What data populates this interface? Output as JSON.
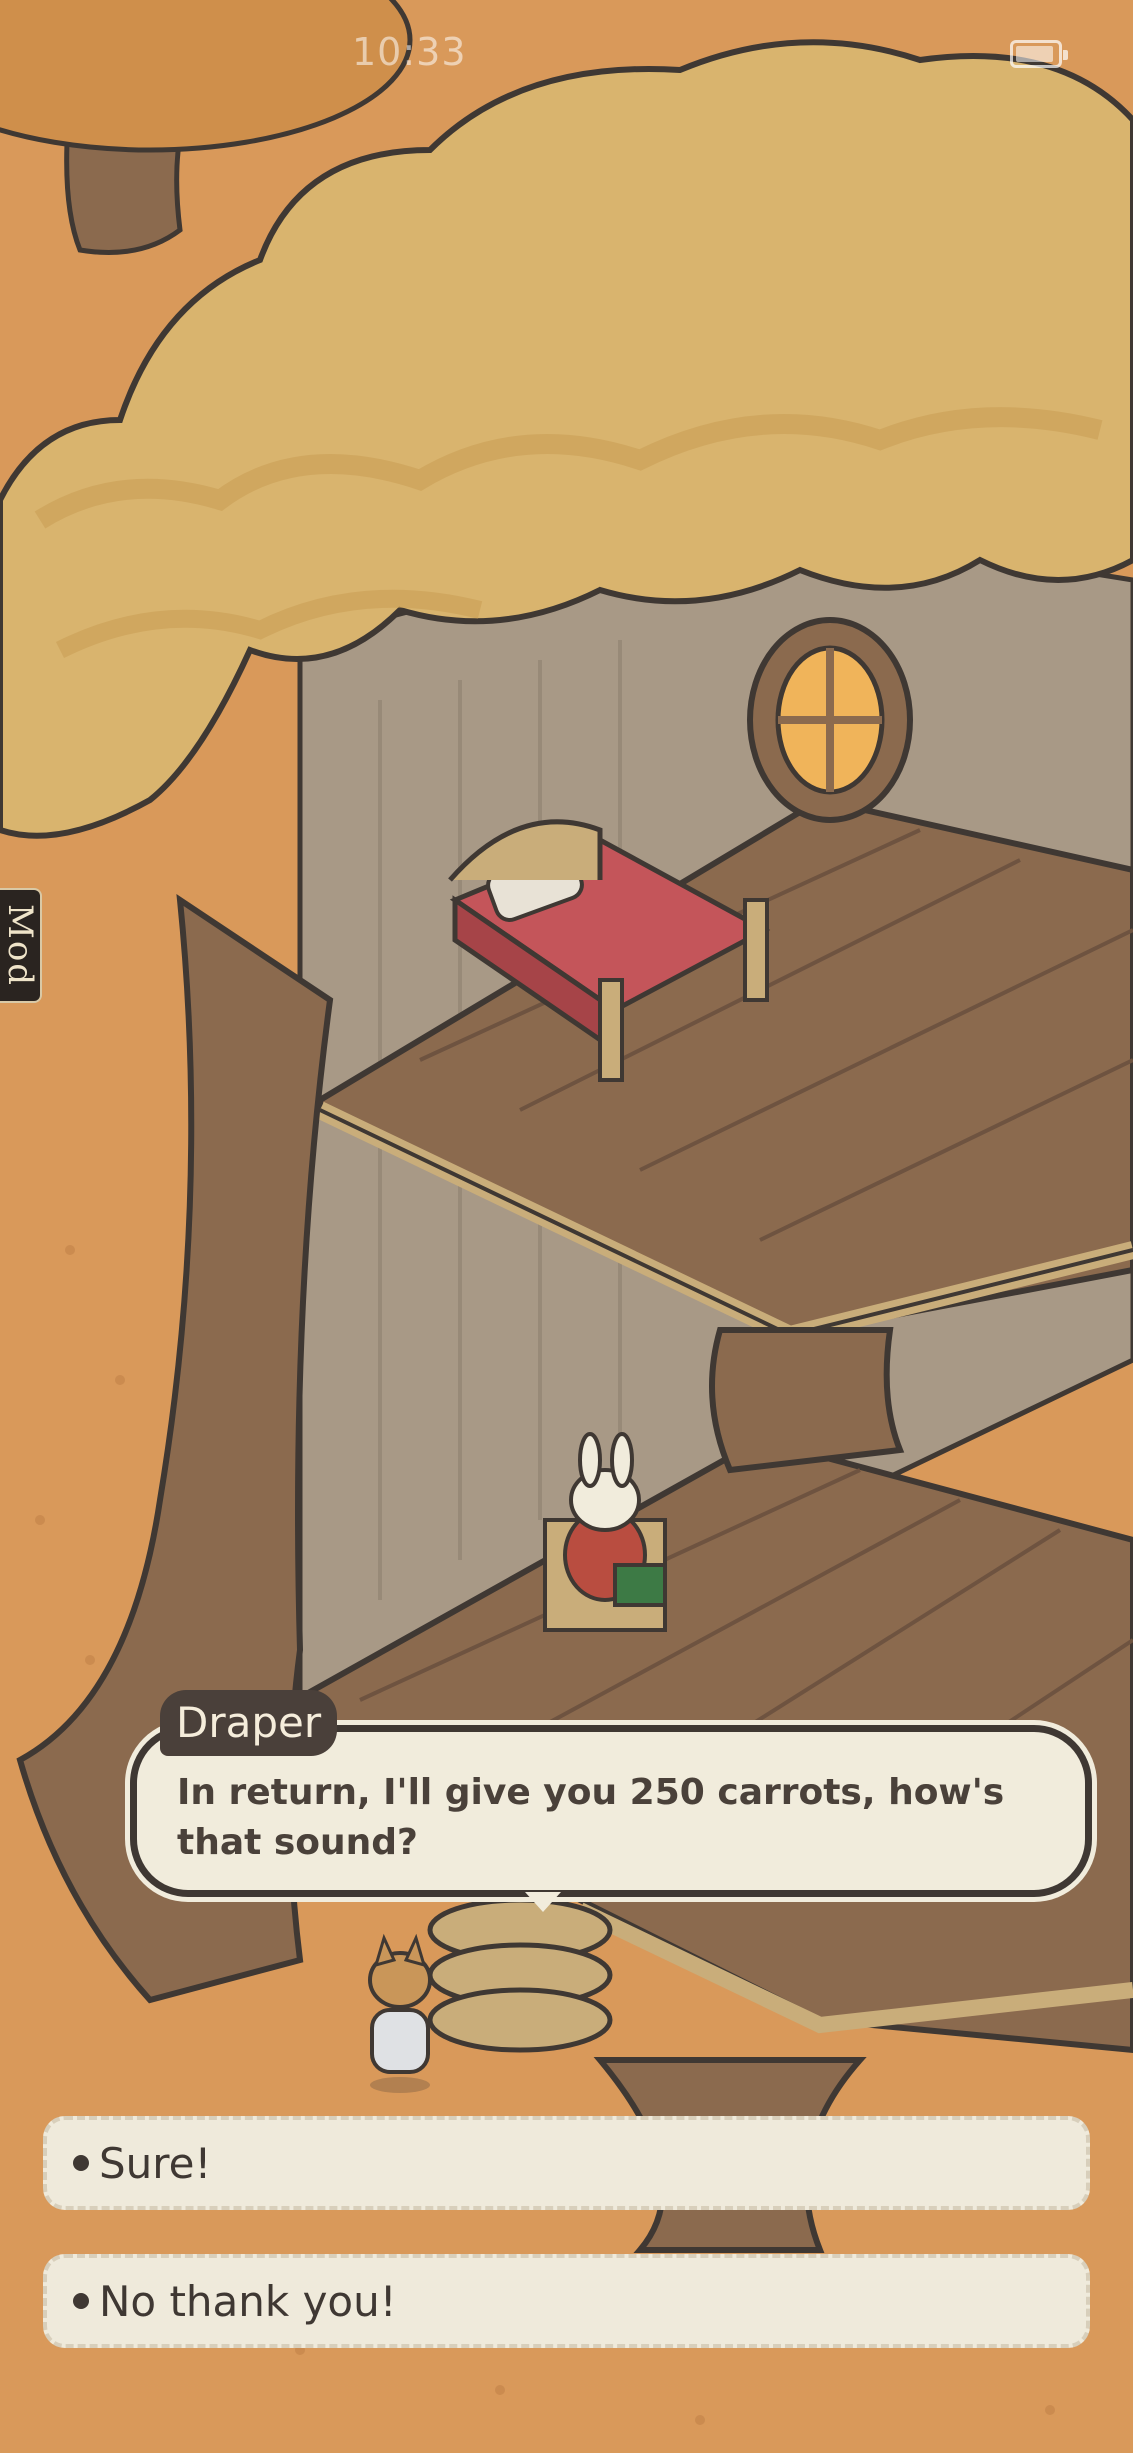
{
  "status_bar": {
    "time": "10:33",
    "battery_icon": "battery-charging-icon"
  },
  "mod_tab": {
    "label": "Mod"
  },
  "dialog": {
    "speaker": "Draper",
    "text": "In return, I'll give you 250 carrots, how's that sound?"
  },
  "choices": [
    {
      "label": "Sure!"
    },
    {
      "label": "No thank you!"
    }
  ],
  "colors": {
    "ground": "#d9995a",
    "foliage": "#d9b46e",
    "floor": "#8b6a4e",
    "wall": "#a89986",
    "dialog_bg": "#f1ecdc",
    "dialog_border": "#3f3833"
  }
}
